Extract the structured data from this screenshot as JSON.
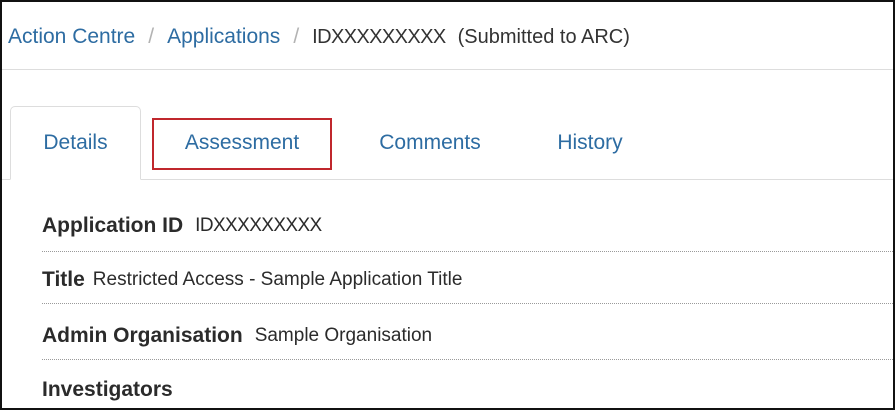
{
  "breadcrumb": {
    "items": [
      {
        "label": "Action Centre"
      },
      {
        "label": "Applications"
      }
    ],
    "separator": "/",
    "current": "IDXXXXXXXXX",
    "status": "(Submitted to ARC)"
  },
  "tabs": [
    {
      "label": "Details",
      "active": true
    },
    {
      "label": "Assessment",
      "highlighted": true
    },
    {
      "label": "Comments"
    },
    {
      "label": "History"
    }
  ],
  "details": {
    "fields": [
      {
        "label": "Application ID",
        "value": "IDXXXXXXXXX"
      },
      {
        "label": "Title",
        "value": "Restricted Access - Sample Application Title"
      },
      {
        "label": "Admin Organisation",
        "value": "Sample Organisation"
      },
      {
        "label": "Investigators",
        "value": ""
      }
    ]
  },
  "colors": {
    "link": "#2d6ca2",
    "highlight_border": "#c0272d",
    "separator": "#b3b3b3"
  }
}
